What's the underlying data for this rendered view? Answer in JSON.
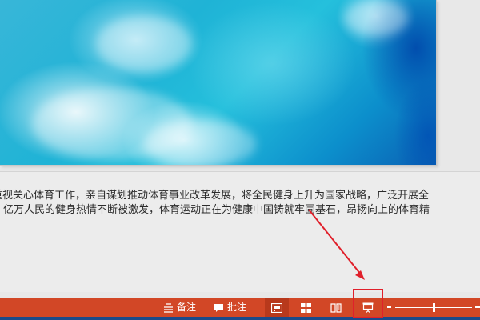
{
  "slide": {
    "image_name": "sky-clouds-image"
  },
  "notes": {
    "line1": "重视关心体育工作，亲自谋划推动体育事业改革发展，将全民健身上升为国家战略，广泛开展全",
    "line2": "亿万人民的健身热情不断被激发，体育运动正在为健康中国铸就牢固基石，昂扬向上的体育精"
  },
  "statusbar": {
    "notes_label": "备注",
    "comments_label": "批注",
    "notes_icon": "notes-icon",
    "comments_icon": "comment-icon",
    "views": [
      {
        "name": "normal-view",
        "icon": "normal-view-icon",
        "active": true
      },
      {
        "name": "slide-sorter-view",
        "icon": "grid-icon",
        "active": false
      },
      {
        "name": "reading-view",
        "icon": "book-icon",
        "active": false
      },
      {
        "name": "slideshow-view",
        "icon": "projector-icon",
        "active": false
      }
    ],
    "zoom_fraction": 0.5
  },
  "colors": {
    "statusbar": "#d24726",
    "annotation": "#e0202b"
  }
}
